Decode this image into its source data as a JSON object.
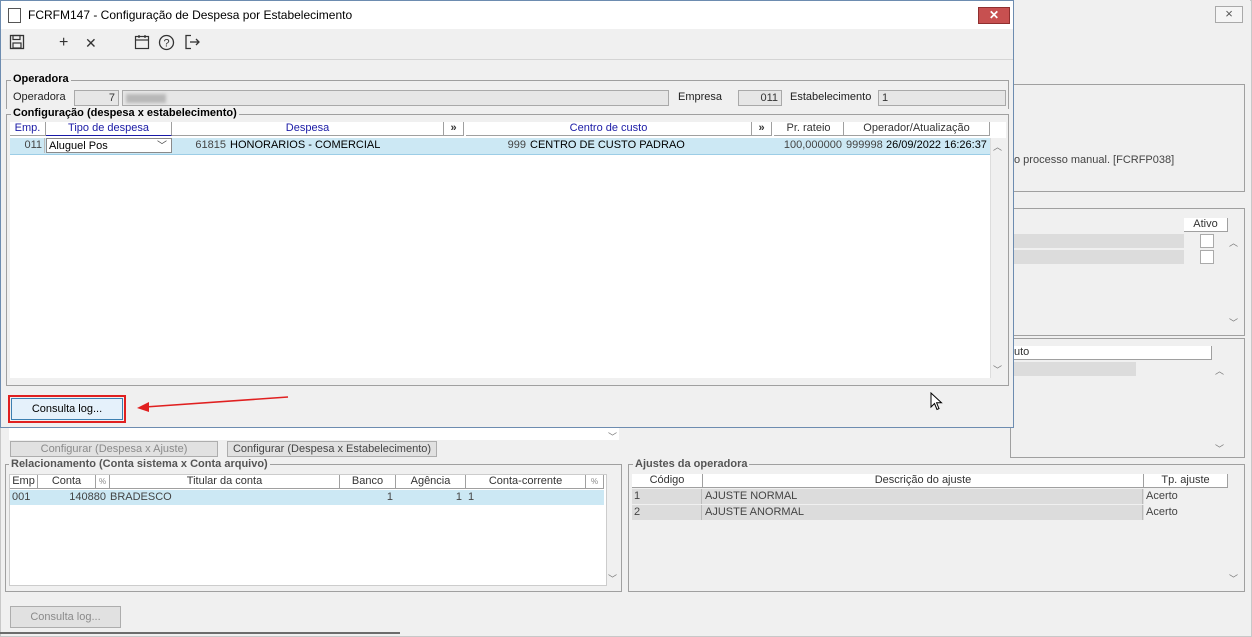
{
  "bg": {
    "close_icon": "×",
    "note_text": "o processo manual. [FCRFP038]",
    "ativo_header": "Ativo",
    "uto_header": "uto",
    "btn_config_ajuste": "Configurar (Despesa x Ajuste)",
    "btn_config_estab": "Configurar (Despesa x Estabelecimento)",
    "relac_title": "Relacionamento (Conta sistema x Conta arquivo)",
    "relac_cols": [
      "Emp",
      "Conta",
      "%",
      "Titular da conta",
      "Banco",
      "Agência",
      "Conta-corrente",
      "%"
    ],
    "relac_row": {
      "emp": "001",
      "conta": "140880",
      "titular": "BRADESCO",
      "banco": "1",
      "agencia": "1",
      "cc": "1"
    },
    "ajustes_title": "Ajustes da operadora",
    "ajustes_cols": [
      "Código",
      "Descrição do ajuste",
      "Tp. ajuste"
    ],
    "ajustes_rows": [
      {
        "codigo": "1",
        "descricao": "AJUSTE NORMAL",
        "tp": "Acerto"
      },
      {
        "codigo": "2",
        "descricao": "AJUSTE ANORMAL",
        "tp": "Acerto"
      }
    ],
    "consulta_log": "Consulta log..."
  },
  "dialog": {
    "title": "FCRFM147 - Configuração de Despesa por Estabelecimento",
    "close_icon": "✕",
    "toolbar": {
      "save": "💾",
      "add": "+",
      "delete": "✕",
      "calendar": "▦",
      "help": "?",
      "exit": "⇥"
    },
    "operadora_group": "Operadora",
    "operadora_label": "Operadora",
    "operadora_code": "7",
    "empresa_label": "Empresa",
    "empresa_value": "011",
    "estabelecimento_label": "Estabelecimento",
    "estabelecimento_value": "1",
    "config_group": "Configuração (despesa x estabelecimento)",
    "columns": {
      "emp": "Emp.",
      "tipo": "Tipo de despesa",
      "despesa": "Despesa",
      "expand": "»",
      "centro": "Centro de custo",
      "rateio": "Pr. rateio",
      "operador": "Operador/Atualização"
    },
    "row": {
      "emp": "011",
      "tipo": "Aluguel Pos",
      "despesa_code": "61815",
      "despesa_desc": "HONORARIOS - COMERCIAL",
      "centro_code": "999",
      "centro_desc": "CENTRO DE CUSTO PADRAO",
      "rateio": "100,000000",
      "operador": "999998",
      "atualizacao": "26/09/2022 16:26:37"
    },
    "consulta_log": "Consulta log..."
  },
  "colors": {
    "accent_red": "#e02020",
    "selection": "#cce8f4",
    "close_red": "#c75050"
  }
}
